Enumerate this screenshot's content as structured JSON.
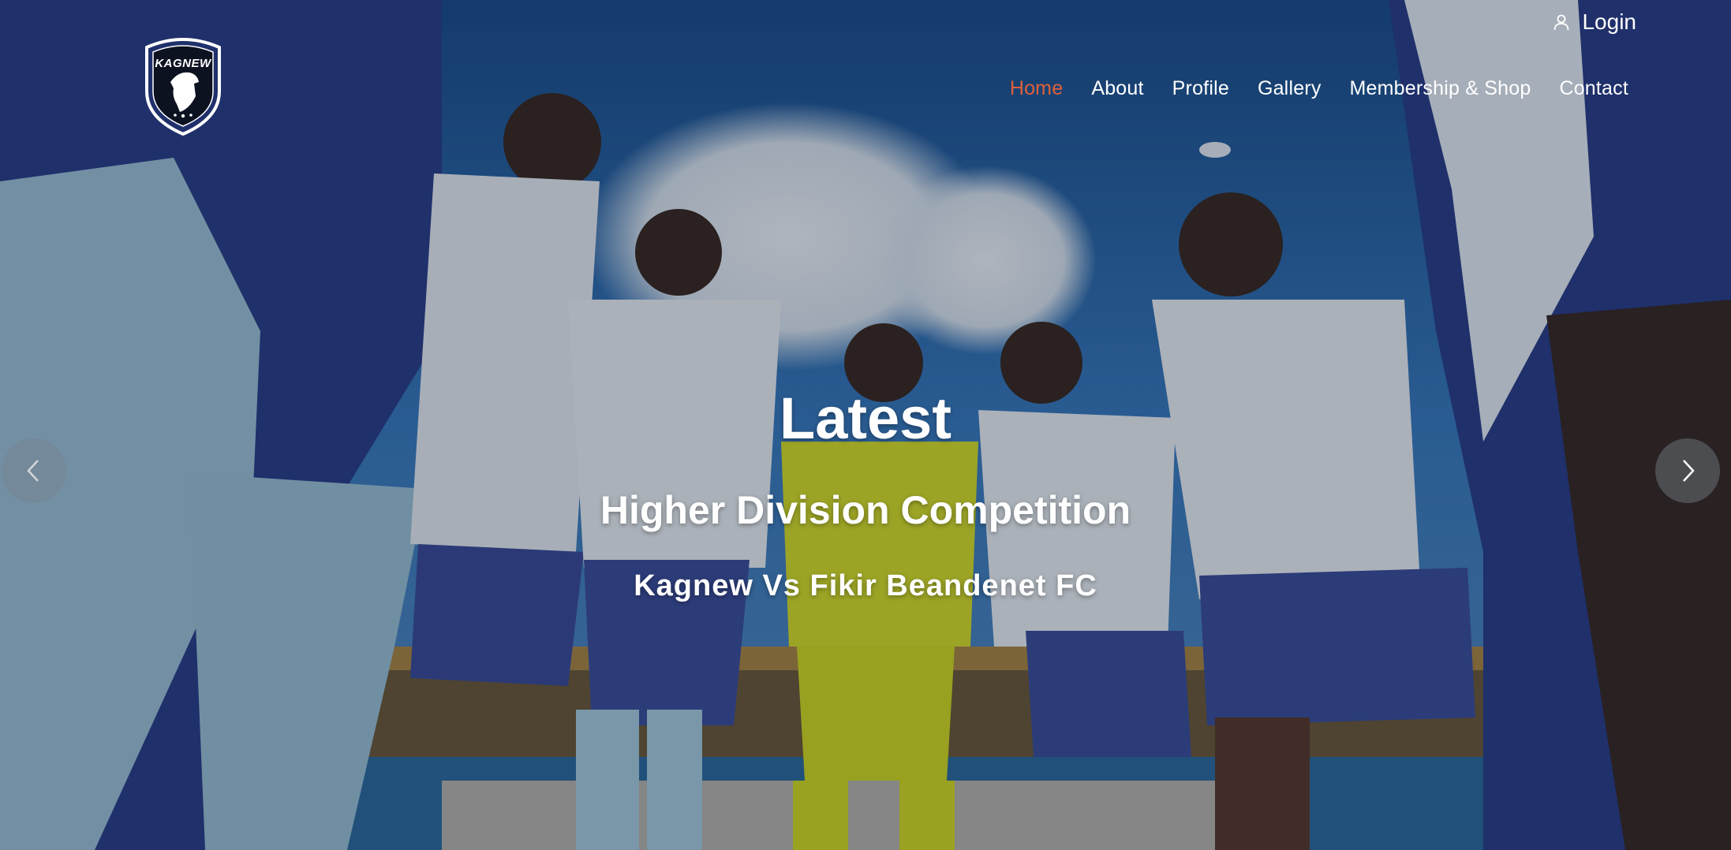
{
  "brand": {
    "logo_text": "KAGNEW",
    "logo_icon": "horse-crest-icon",
    "accent_color": "#e0603a"
  },
  "header": {
    "login_label": "Login",
    "login_icon": "user-icon"
  },
  "nav": {
    "items": [
      {
        "label": "Home",
        "active": true
      },
      {
        "label": "About",
        "active": false
      },
      {
        "label": "Profile",
        "active": false
      },
      {
        "label": "Gallery",
        "active": false
      },
      {
        "label": "Membership & Shop",
        "active": false
      },
      {
        "label": "Contact",
        "active": false
      }
    ]
  },
  "hero": {
    "title": "Latest",
    "subtitle": "Higher Division Competition",
    "match": "Kagnew Vs Fikir Beandenet FC",
    "prev_icon": "chevron-left-icon",
    "next_icon": "chevron-right-icon"
  }
}
